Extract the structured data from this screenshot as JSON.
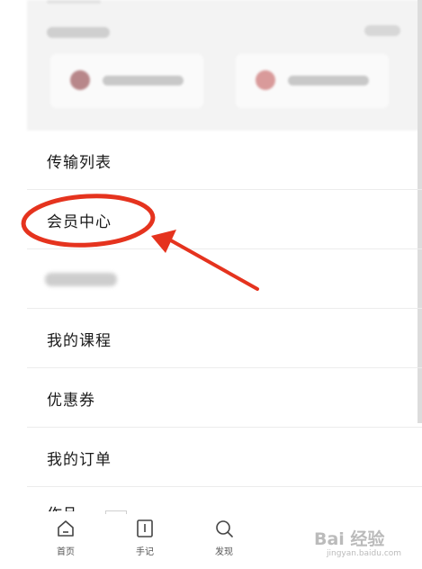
{
  "menu": {
    "items": [
      {
        "label": "传输列表"
      },
      {
        "label": "会员中心"
      },
      {
        "label": ""
      },
      {
        "label": "我的课程"
      },
      {
        "label": "优惠券"
      },
      {
        "label": "我的订单"
      }
    ],
    "partial_item": "作品"
  },
  "tabbar": {
    "tabs": [
      {
        "label": "首页",
        "icon": "home-icon"
      },
      {
        "label": "手记",
        "icon": "notebook-icon"
      },
      {
        "label": "发现",
        "icon": "search-icon"
      }
    ]
  },
  "watermark": {
    "main": "Bai 经验",
    "sub": "jingyan.baidu.com"
  },
  "annotation_color": "#e5331e"
}
